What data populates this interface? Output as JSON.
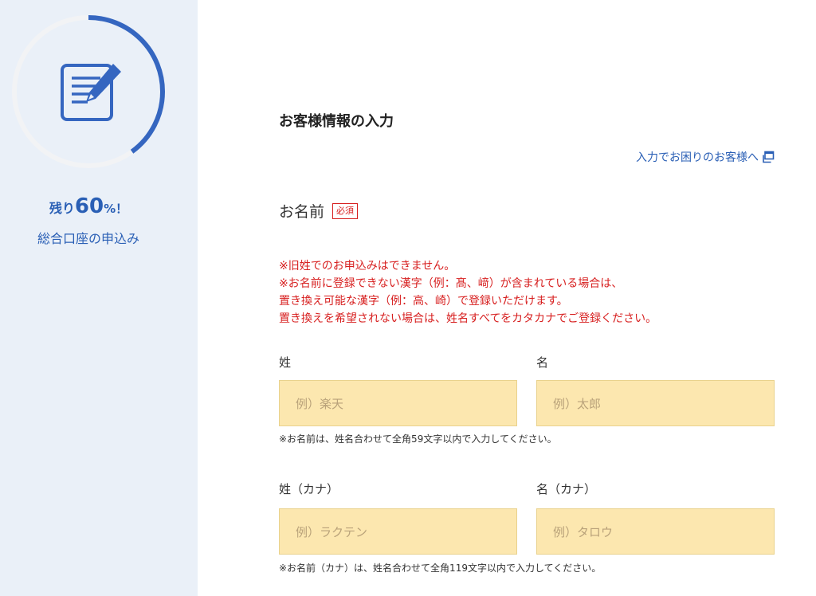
{
  "sidebar": {
    "progress_prefix": "残り",
    "progress_value": "60",
    "progress_suffix": "%！",
    "progress_fraction": 0.4,
    "application_name": "総合口座の申込み",
    "icon": "document-edit-icon",
    "accent_color": "#3566c0"
  },
  "main": {
    "title": "お客様情報の入力",
    "help_link": "入力でお困りのお客様へ",
    "help_icon": "external-window-icon",
    "name_section": {
      "label": "お名前",
      "required_badge": "必須",
      "notices": [
        "※旧姓でのお申込みはできません。",
        "※お名前に登録できない漢字（例：髙、﨑）が含まれている場合は、",
        "置き換え可能な漢字（例：高、崎）で登録いただけます。",
        "置き換えを希望されない場合は、姓名すべてをカタカナでご登録ください。"
      ],
      "last_name_label": "姓",
      "first_name_label": "名",
      "last_name_placeholder": "例）楽天",
      "first_name_placeholder": "例）太郎",
      "kanji_note": "※お名前は、姓名合わせて全角59文字以内で入力してください。",
      "last_kana_label": "姓（カナ）",
      "first_kana_label": "名（カナ）",
      "last_kana_placeholder": "例）ラクテン",
      "first_kana_placeholder": "例）タロウ",
      "kana_note": "※お名前（カナ）は、姓名合わせて全角119文字以内で入力してください。"
    }
  },
  "colors": {
    "sidebar_bg": "#eaf0f8",
    "accent": "#2a5fb5",
    "error": "#d71f1f",
    "input_bg": "#fce7af"
  }
}
